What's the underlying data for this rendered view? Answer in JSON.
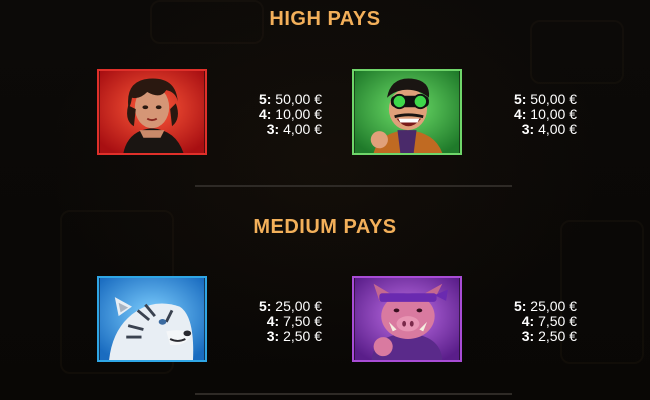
{
  "sections": [
    {
      "title": "HIGH PAYS",
      "symbols": [
        {
          "icon": "woman-character-icon",
          "border_color": "#e0302a",
          "pays": [
            {
              "count": "5:",
              "amount": "50,00 €"
            },
            {
              "count": "4:",
              "amount": "10,00 €"
            },
            {
              "count": "3:",
              "amount": "4,00 €"
            }
          ]
        },
        {
          "icon": "goggles-man-character-icon",
          "border_color": "#6fd66a",
          "pays": [
            {
              "count": "5:",
              "amount": "50,00 €"
            },
            {
              "count": "4:",
              "amount": "10,00 €"
            },
            {
              "count": "3:",
              "amount": "4,00 €"
            }
          ]
        }
      ]
    },
    {
      "title": "MEDIUM PAYS",
      "symbols": [
        {
          "icon": "white-tiger-character-icon",
          "border_color": "#2fa6e6",
          "pays": [
            {
              "count": "5:",
              "amount": "25,00 €"
            },
            {
              "count": "4:",
              "amount": "7,50 €"
            },
            {
              "count": "3:",
              "amount": "2,50 €"
            }
          ]
        },
        {
          "icon": "boar-character-icon",
          "border_color": "#a84cd6",
          "pays": [
            {
              "count": "5:",
              "amount": "25,00 €"
            },
            {
              "count": "4:",
              "amount": "7,50 €"
            },
            {
              "count": "3:",
              "amount": "2,50 €"
            }
          ]
        }
      ]
    }
  ],
  "colors": {
    "title": "#f3b05a",
    "divider": "#2e2a26",
    "background": "#0b0907"
  }
}
